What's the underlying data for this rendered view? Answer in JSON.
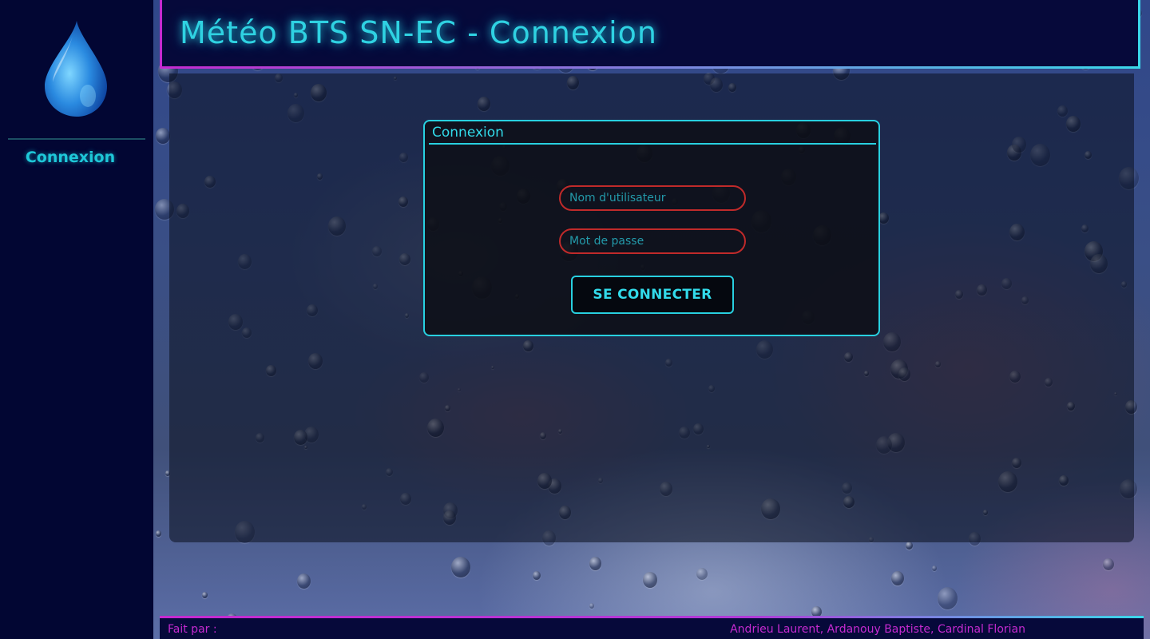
{
  "app": {
    "title": "Météo BTS SN-EC - Connexion"
  },
  "sidebar": {
    "logo_icon": "water-drop-icon",
    "nav_label": "Connexion"
  },
  "login": {
    "title": "Connexion",
    "username_placeholder": "Nom d'utilisateur",
    "username_value": "",
    "password_placeholder": "Mot de passe",
    "password_value": "",
    "submit_label": "SE CONNECTER"
  },
  "footer": {
    "label": "Fait par :",
    "authors": "Andrieu Laurent, Ardanouy Baptiste, Cardinal Florian"
  },
  "colors": {
    "accent_cyan": "#28d0e0",
    "accent_magenta": "#c52ad0",
    "input_border": "#c02a2a",
    "sidebar_bg": "#020633"
  }
}
